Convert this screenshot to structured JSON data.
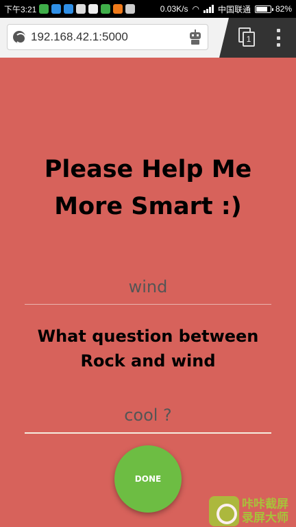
{
  "status_bar": {
    "time": "下午3:21",
    "net_speed": "0.03K/s",
    "carrier": "中国联通",
    "battery_text": "82%",
    "battery_level": 0.82
  },
  "browser": {
    "url": "192.168.42.1:5000",
    "tab_count": "1"
  },
  "page": {
    "title": "Please Help Me More Smart :)",
    "answer1_value": "wind",
    "question": "What question between Rock and wind",
    "answer2_value": "cool ?",
    "done_label": "DONE"
  },
  "watermark": {
    "line1": "咔咔截屏",
    "line2": "录屏大师"
  },
  "colors": {
    "background": "#d7625b",
    "done_button": "#6dbd43",
    "watermark": "#a8c23a"
  }
}
